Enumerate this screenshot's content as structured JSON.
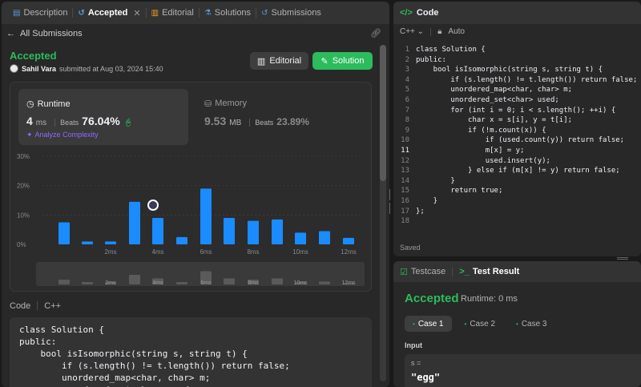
{
  "tabs": [
    {
      "label": "Description",
      "icon": "description-icon",
      "active": false
    },
    {
      "label": "Accepted",
      "icon": "history-icon",
      "active": true
    },
    {
      "label": "Editorial",
      "icon": "book-icon",
      "active": false
    },
    {
      "label": "Solutions",
      "icon": "flask-icon",
      "active": false
    },
    {
      "label": "Submissions",
      "icon": "history-icon",
      "active": false
    }
  ],
  "subnav": {
    "back_label": "All Submissions"
  },
  "submission": {
    "status": "Accepted",
    "author": "Sahil Vara",
    "submitted_text": "submitted at Aug 03, 2024 15:40",
    "editorial_label": "Editorial",
    "solution_label": "Solution"
  },
  "runtime": {
    "label": "Runtime",
    "value": "4",
    "unit": "ms",
    "beats_label": "Beats",
    "beats": "76.04%",
    "analyze_label": "Analyze Complexity"
  },
  "memory": {
    "label": "Memory",
    "value": "9.53",
    "unit": "MB",
    "beats_label": "Beats",
    "beats": "23.89%"
  },
  "chart_data": {
    "type": "bar",
    "y_ticks": [
      "30%",
      "20%",
      "10%",
      "0%"
    ],
    "ylim": [
      0,
      30
    ],
    "x_tick_labels": [
      "2ms",
      "4ms",
      "6ms",
      "8ms",
      "10ms",
      "12ms"
    ],
    "x": [
      0.5,
      1,
      1.5,
      3,
      4,
      5,
      6,
      7,
      8,
      9,
      10,
      11,
      12
    ],
    "values": [
      7.5,
      1,
      1,
      14.5,
      9,
      2.5,
      19,
      9,
      8,
      8.5,
      4,
      4.5,
      2.2
    ],
    "highlight_index": 4,
    "bar_color": "#1a8cff",
    "overview_values": [
      2,
      1,
      1,
      4,
      2.5,
      1,
      5.5,
      2.5,
      2,
      2.5,
      1,
      1.2,
      0.6
    ]
  },
  "code_panel": {
    "label": "Code",
    "language": "C++",
    "lines": [
      "class Solution {",
      "public:",
      "    bool isIsomorphic(string s, string t) {",
      "        if (s.length() != t.length()) return false;",
      "        unordered_map<char, char> m;",
      "        unordered_set<char> used;"
    ]
  },
  "editor": {
    "title": "Code",
    "language": "C++",
    "mode": "Auto",
    "current_line": 11,
    "lines": [
      "class Solution {",
      "public:",
      "    bool isIsomorphic(string s, string t) {",
      "        if (s.length() != t.length()) return false;",
      "        unordered_map<char, char> m;",
      "        unordered_set<char> used;",
      "        for (int i = 0; i < s.length(); ++i) {",
      "            char x = s[i], y = t[i];",
      "            if (!m.count(x)) {",
      "                if (used.count(y)) return false;",
      "                m[x] = y;",
      "                used.insert(y);",
      "            } else if (m[x] != y) return false;",
      "        }",
      "        return true;",
      "    }",
      "};",
      ""
    ],
    "saved_label": "Saved"
  },
  "testcase": {
    "tab1": "Testcase",
    "tab2": "Test Result",
    "status": "Accepted",
    "runtime": "Runtime: 0 ms",
    "cases": [
      "Case 1",
      "Case 2",
      "Case 3"
    ],
    "input_label": "Input",
    "input_var": "s =",
    "input_value": "\"egg\""
  },
  "colors": {
    "accent_green": "#2cbb5d",
    "bar_blue": "#1a8cff",
    "purple": "#8e6bff"
  }
}
